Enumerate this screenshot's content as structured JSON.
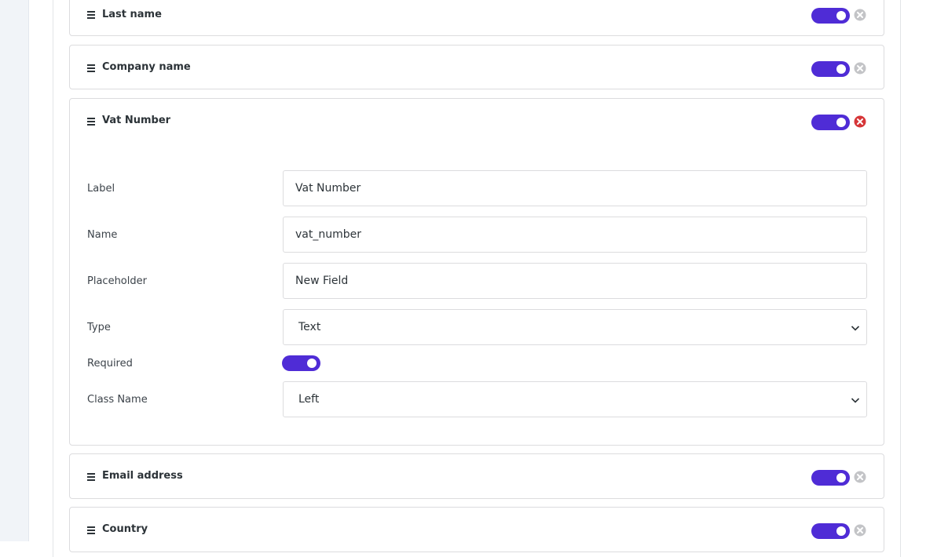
{
  "fields": [
    {
      "title": "Last name",
      "enabled": true,
      "remove_state": "inactive"
    },
    {
      "title": "Company name",
      "enabled": true,
      "remove_state": "inactive"
    },
    {
      "title": "Vat Number",
      "enabled": true,
      "remove_state": "active"
    },
    {
      "title": "Email address",
      "enabled": true,
      "remove_state": "inactive"
    },
    {
      "title": "Country",
      "enabled": true,
      "remove_state": "inactive"
    }
  ],
  "expanded_field": {
    "label_label": "Label",
    "label_value": "Vat Number",
    "name_label": "Name",
    "name_value": "vat_number",
    "placeholder_label": "Placeholder",
    "placeholder_value": "New Field",
    "type_label": "Type",
    "type_value": "Text",
    "required_label": "Required",
    "required_value": true,
    "class_name_label": "Class Name",
    "class_name_value": "Left"
  },
  "colors": {
    "toggle_on": "#4f2cd6",
    "remove_active": "#d63638",
    "remove_inactive": "#c3c4c7"
  },
  "icons": {
    "drag": "drag-handle-icon",
    "remove": "remove-circle-icon",
    "dropdown": "chevron-down-icon"
  }
}
